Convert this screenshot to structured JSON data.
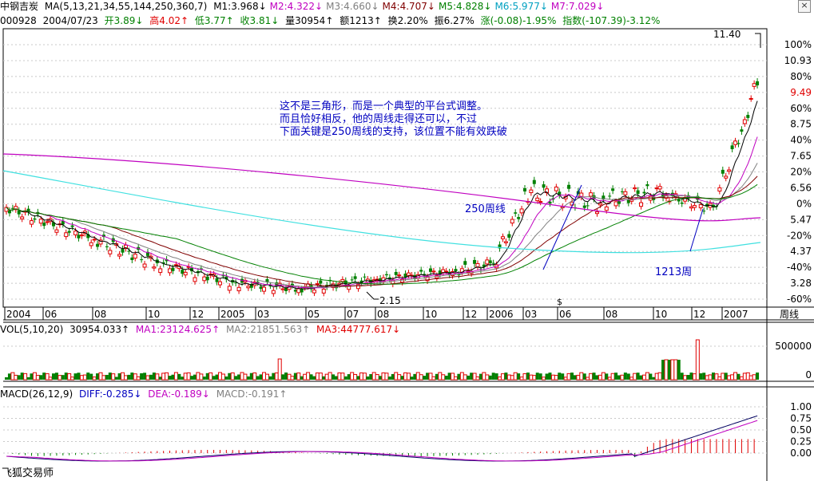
{
  "window": {
    "title": "中钢吉炭",
    "close_icon": "close-icon",
    "app_name": "飞狐交易师"
  },
  "ma_line": {
    "label": "MA(5,13,21,34,55,144,250,360,7)",
    "items": [
      {
        "text": "M1:3.968",
        "arrow": "↓",
        "color": "#000000"
      },
      {
        "text": "M2:4.322",
        "arrow": "↓",
        "color": "#c000c0"
      },
      {
        "text": "M3:4.660",
        "arrow": "↓",
        "color": "#808080"
      },
      {
        "text": "M4:4.707",
        "arrow": "↓",
        "color": "#800000"
      },
      {
        "text": "M5:4.828",
        "arrow": "↓",
        "color": "#008000"
      },
      {
        "text": "M6:5.977",
        "arrow": "↓",
        "color": "#00a0c0"
      },
      {
        "text": "M7:7.029",
        "arrow": "↓",
        "color": "#c000c0"
      }
    ]
  },
  "quote_line": {
    "code": "000928",
    "date": "2004/07/23",
    "open": "开3.89",
    "open_arrow": "↓",
    "high": "高4.02",
    "high_arrow": "↑",
    "low": "低3.77",
    "low_arrow": "↑",
    "close": "收3.81",
    "close_arrow": "↓",
    "volume": "量30954",
    "volume_arrow": "↑",
    "amount": "额1213",
    "amount_arrow": "↑",
    "turnover": "换2.20%",
    "amplitude": "振6.27%",
    "change": "涨(-0.08)-1.95%",
    "index": "指数(-107.39)-3.12%"
  },
  "annotations": {
    "note_line1": "这不是三角形，而是一个典型的平台式调整。",
    "note_line2": "而且恰好相反，他的周线走得还可以，不过",
    "note_line3": "下面关键是250周线的支持，该位置不能有效跌破",
    "ma250_label": "250周线",
    "week1213_label": "1213周",
    "low_value": "2.15",
    "peak_value": "11.40",
    "current_price": "9.49",
    "event_marker": "$"
  },
  "price_axis": {
    "labels": [
      "100%",
      "10.93",
      "80%",
      "9.49",
      "60%",
      "8.75",
      "40%",
      "7.65",
      "20%",
      "6.56",
      "0%",
      "5.47",
      "-20%",
      "4.37",
      "-40%",
      "3.28",
      "-60%"
    ]
  },
  "time_axis": {
    "labels": [
      "2004",
      "06",
      "08",
      "10",
      "12",
      "2005",
      "03",
      "05",
      "07",
      "08",
      "10",
      "12",
      "2006",
      "03",
      "06",
      "08",
      "10",
      "12",
      "2007"
    ],
    "unit": "周线"
  },
  "volume_panel": {
    "label": "VOL(5,10,20)",
    "value": "30954.033",
    "value_arrow": "↑",
    "ma1": "MA1:23124.625",
    "ma1_arrow": "↑",
    "ma2": "MA2:21851.563",
    "ma2_arrow": "↑",
    "ma3": "MA3:44777.617",
    "ma3_arrow": "↓",
    "axis": [
      "500000",
      "0"
    ]
  },
  "macd_panel": {
    "label": "MACD(26,12,9)",
    "diff": "DIFF:-0.285",
    "diff_arrow": "↓",
    "dea": "DEA:-0.189",
    "dea_arrow": "↓",
    "macd": "MACD:-0.191",
    "macd_arrow": "↑",
    "axis": [
      "1.00",
      "0.75",
      "0.50",
      "0.25",
      "0.00"
    ]
  },
  "colors": {
    "up": "#e00000",
    "down": "#008000",
    "grid": "#c8c8c8",
    "ma_long": "#c000c0",
    "ma_cyan": "#40e0e0",
    "annotation": "#0000c0"
  }
}
